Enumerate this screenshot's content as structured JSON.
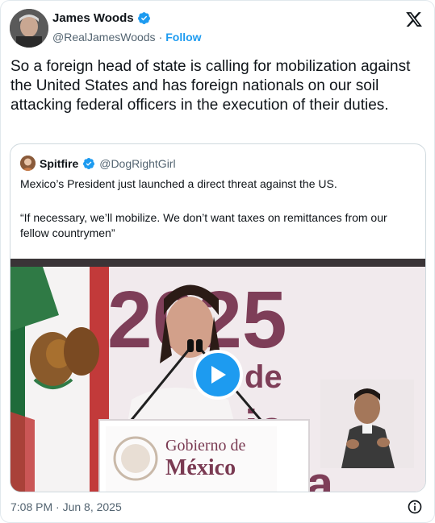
{
  "author": {
    "name": "James Woods",
    "handle": "@RealJamesWoods",
    "separator": "·",
    "follow_label": "Follow"
  },
  "tweet": {
    "text": "So a foreign head of state is calling for mobilization against the United States and has foreign nationals on our soil attacking federal officers in the execution of their duties."
  },
  "quote": {
    "name": "Spitfire",
    "handle": "@DogRightGirl",
    "text_line1": "Mexico’s President just launched a direct threat against the US.",
    "text_line2": "“If necessary, we’ll mobilize. We don’t want taxes on remittances from our fellow countrymen”",
    "media": {
      "backdrop_year": "2025",
      "backdrop_word1": "de",
      "backdrop_word2": "ie",
      "backdrop_word3": "na",
      "podium_line1": "Gobierno de",
      "podium_line2": "México"
    }
  },
  "footer": {
    "timestamp": "7:08 PM · Jun 8, 2025"
  },
  "icons": {
    "verified": "verified-badge-icon",
    "x_logo": "x-logo-icon",
    "play": "play-icon",
    "info": "info-icon"
  },
  "colors": {
    "accent": "#1d9bf0",
    "text": "#0f1419",
    "muted": "#536471",
    "border": "#cfd9de"
  }
}
